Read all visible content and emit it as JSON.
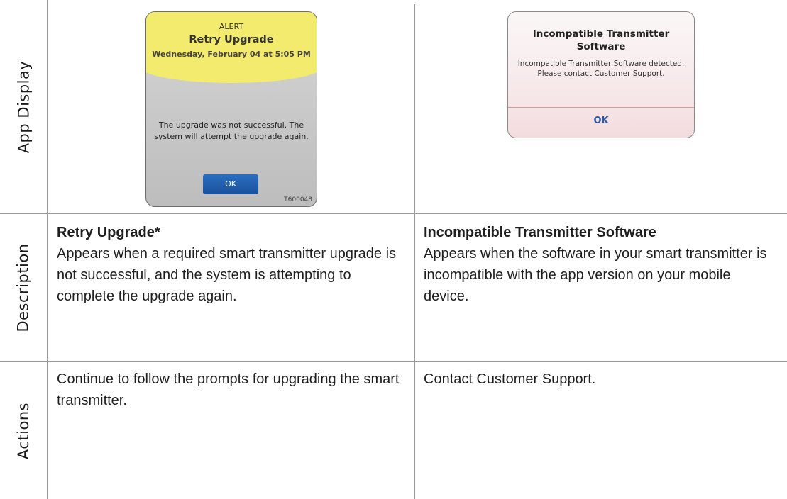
{
  "row_labels": {
    "app_display": "App Display",
    "description": "Description",
    "actions": "Actions"
  },
  "retry_screen": {
    "header_label": "ALERT",
    "title": "Retry Upgrade",
    "date": "Wednesday, February 04 at 5:05 PM",
    "message": "The upgrade was not successful. The system will attempt the upgrade again.",
    "ok_label": "OK",
    "image_id": "T600048",
    "header_color": "#f2eb6e",
    "button_color": "#1f5fb0"
  },
  "incompatible_screen": {
    "title": "Incompatible Transmitter Software",
    "message": "Incompatible Transmitter Software detected. Please contact Customer Support.",
    "ok_label": "OK",
    "background_color": "#f6e6e8",
    "button_text_color": "#2a5aa6"
  },
  "descriptions": {
    "left": {
      "title": "Retry Upgrade*",
      "text": "Appears when a required smart transmitter upgrade is not successful, and the system is attempting to complete the upgrade again."
    },
    "right": {
      "title": "Incompatible Transmitter Software",
      "text": "Appears when the software in your smart transmitter is incompatible with the app version on your mobile device."
    }
  },
  "actions": {
    "left": "Continue to follow the prompts for upgrading the smart transmitter.",
    "right": "Contact Customer Support."
  }
}
